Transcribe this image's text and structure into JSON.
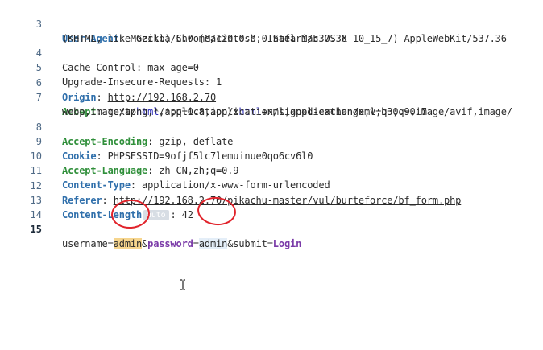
{
  "lines": [
    {
      "num": "3",
      "a_name": "User-Agent",
      "a_sep": ":",
      "a_val": " Mozilla/5.0 (Macintosh; Intel Mac OS X 10_15_7) AppleWebKit/537.36"
    },
    {
      "num": "",
      "wrap": "(KHTML, like Gecko) Chrome/120.0.0.0 Safari/537.36"
    },
    {
      "num": "4",
      "plain": "Cache-Control: max-age=0"
    },
    {
      "num": "5",
      "plain": "Upgrade-Insecure-Requests: 1"
    },
    {
      "num": "6",
      "name": "Origin",
      "sep": ":",
      "url": "http://192.168.2.70"
    },
    {
      "num": "7",
      "name": "Accept",
      "sep": ":",
      "val_pre": " text/",
      "val_kw1": "html",
      "val_mid": ",application/x",
      "val_kw2": "html",
      "val_post": "+xml,application/xml;q=0.9,image/avif,image/"
    },
    {
      "num": "",
      "wrap": "webp,image/apng,*/*;q=0.8,application/signed-exchange;v=b3;q=0.7"
    },
    {
      "num": "8",
      "name": "Accept-Encoding",
      "sep": ":",
      "val": " gzip, deflate"
    },
    {
      "num": "9",
      "name": "Cookie",
      "sep": ":",
      "val": " PHPSESSID=9ofjf5lc7lemuinue0qo6cv6l0"
    },
    {
      "num": "10",
      "name": "Accept-Language",
      "sep": ":",
      "val": " zh-CN,zh;q=0.9"
    },
    {
      "num": "11",
      "name": "Content-Type",
      "sep": ":",
      "val": " application/x-www-form-urlencoded"
    },
    {
      "num": "12",
      "name": "Referer",
      "sep": ":",
      "url": "http://192.168.2.70/pikachu-master/vul/burteforce/bf_form.php"
    },
    {
      "num": "13",
      "name": "Content-Length",
      "badge": "auto",
      "sep": ":",
      "val": " 42"
    },
    {
      "num": "14"
    },
    {
      "num": "15",
      "p1": "username=",
      "v1": "admin",
      "amp1": "&",
      "p2": "password",
      "eq2": "=",
      "v2": "admin",
      "amp2": "&",
      "p3": "submit=",
      "v3": "Login"
    }
  ],
  "colors": {
    "header_name": "#2f6fab",
    "header_name_green": "#2f8f3a",
    "annotation_circle": "#e1232b",
    "highlight_orange": "#f6d58d",
    "highlight_blue": "#e4eef8"
  },
  "icons": {
    "cursor": "text-cursor-icon"
  }
}
